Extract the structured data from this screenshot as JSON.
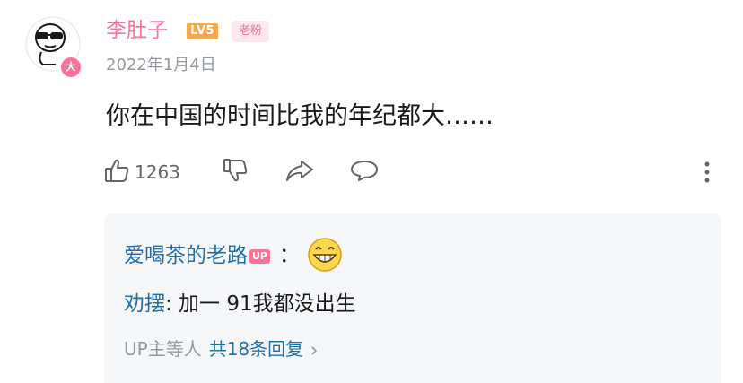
{
  "comment": {
    "username": "李肚子",
    "level_badge": "LV5",
    "fan_badge": "老粉",
    "avatar_badge": "大",
    "date": "2022年1月4日",
    "text": "你在中国的时间比我的年纪都大……",
    "like_count": "1263"
  },
  "replies": [
    {
      "name": "爱喝茶的老路",
      "up_badge": "UP",
      "colon": "：",
      "emoji": "grinning-face-emoji"
    },
    {
      "name": "劝摆",
      "text": ": 加一 91我都没出生"
    }
  ],
  "reply_summary": {
    "label": "UP主等人",
    "count_text": "共18条回复"
  },
  "icons": [
    "thumbs-up-icon",
    "thumbs-down-icon",
    "share-icon",
    "reply-icon",
    "more-vertical-icon",
    "chevron-right-icon"
  ],
  "colors": {
    "accent_pink": "#fb7299",
    "link_blue": "#1f6fa8",
    "muted_gray": "#9499a0",
    "level_orange": "#f6a84b"
  }
}
